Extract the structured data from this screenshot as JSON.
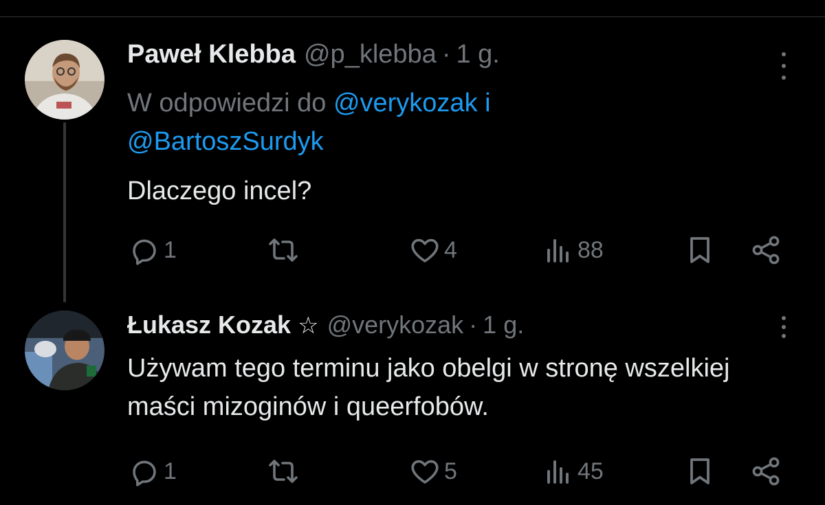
{
  "tweets": [
    {
      "name": "Paweł Klebba",
      "handle": "@p_klebba",
      "separator": "·",
      "time": "1 g.",
      "reply_prefix": "W odpowiedzi do ",
      "mention1": "@verykozak",
      "conj": " i",
      "mention2": "@BartoszSurdyk",
      "text": "Dlaczego incel?",
      "replies": "1",
      "likes": "4",
      "views": "88"
    },
    {
      "name": "Łukasz Kozak",
      "badge": "☆",
      "handle": "@verykozak",
      "separator": "·",
      "time": "1 g.",
      "text": "Używam tego terminu jako obelgi w stronę wszelkiej maści mizoginów i queerfobów.",
      "replies": "1",
      "likes": "5",
      "views": "45"
    }
  ],
  "colors": {
    "background": "#000000",
    "text": "#e7e9ea",
    "muted": "#71767b",
    "link": "#1d9bf0"
  },
  "icons": [
    "more-icon",
    "reply-icon",
    "retweet-icon",
    "like-icon",
    "views-icon",
    "bookmark-icon",
    "share-icon"
  ]
}
